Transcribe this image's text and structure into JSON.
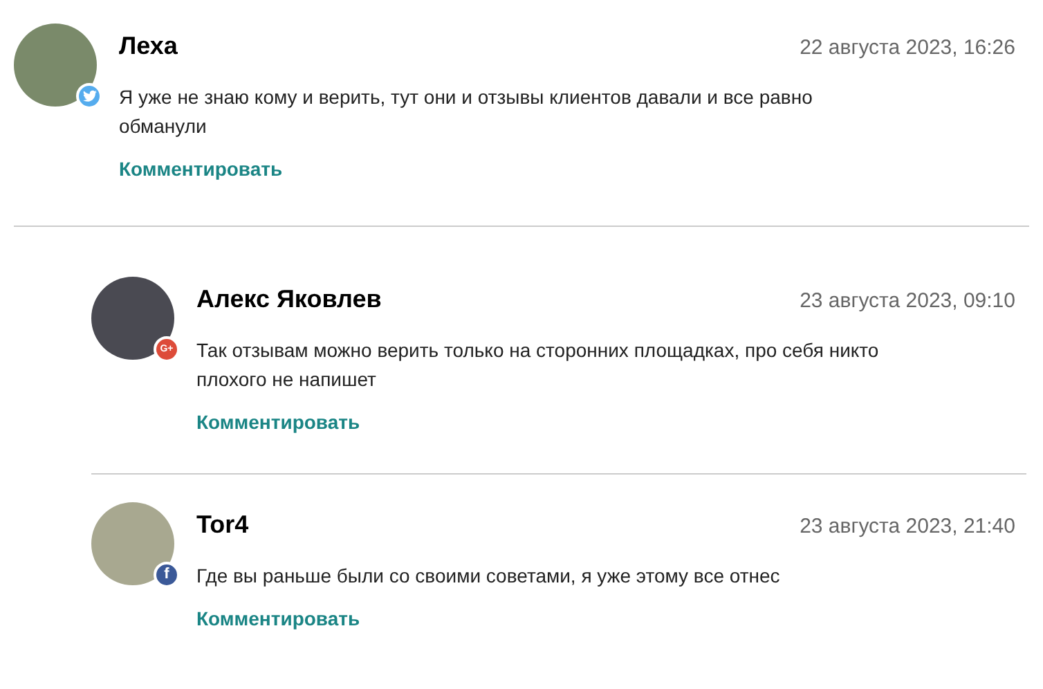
{
  "comments": [
    {
      "author": "Леха",
      "date": "22 августа 2023, 16:26",
      "text": "Я уже не знаю кому и верить, тут они и отзывы клиентов давали и все равно обманули",
      "action": "Комментировать",
      "badge": {
        "kind": "twitter"
      },
      "children": [
        {
          "author": "Алекс Яковлев",
          "date": "23 августа 2023, 09:10",
          "text": "Так отзывам можно верить только на сторонних площадках, про себя никто плохого не напишет",
          "action": "Комментировать",
          "badge": {
            "kind": "google",
            "glyph": "G+"
          }
        },
        {
          "author": "Tor4",
          "date": "23 августа 2023, 21:40",
          "text": "Где вы раньше были со своими советами, я уже этому все отнес",
          "action": "Комментировать",
          "badge": {
            "kind": "facebook",
            "glyph": "f"
          }
        }
      ]
    }
  ]
}
